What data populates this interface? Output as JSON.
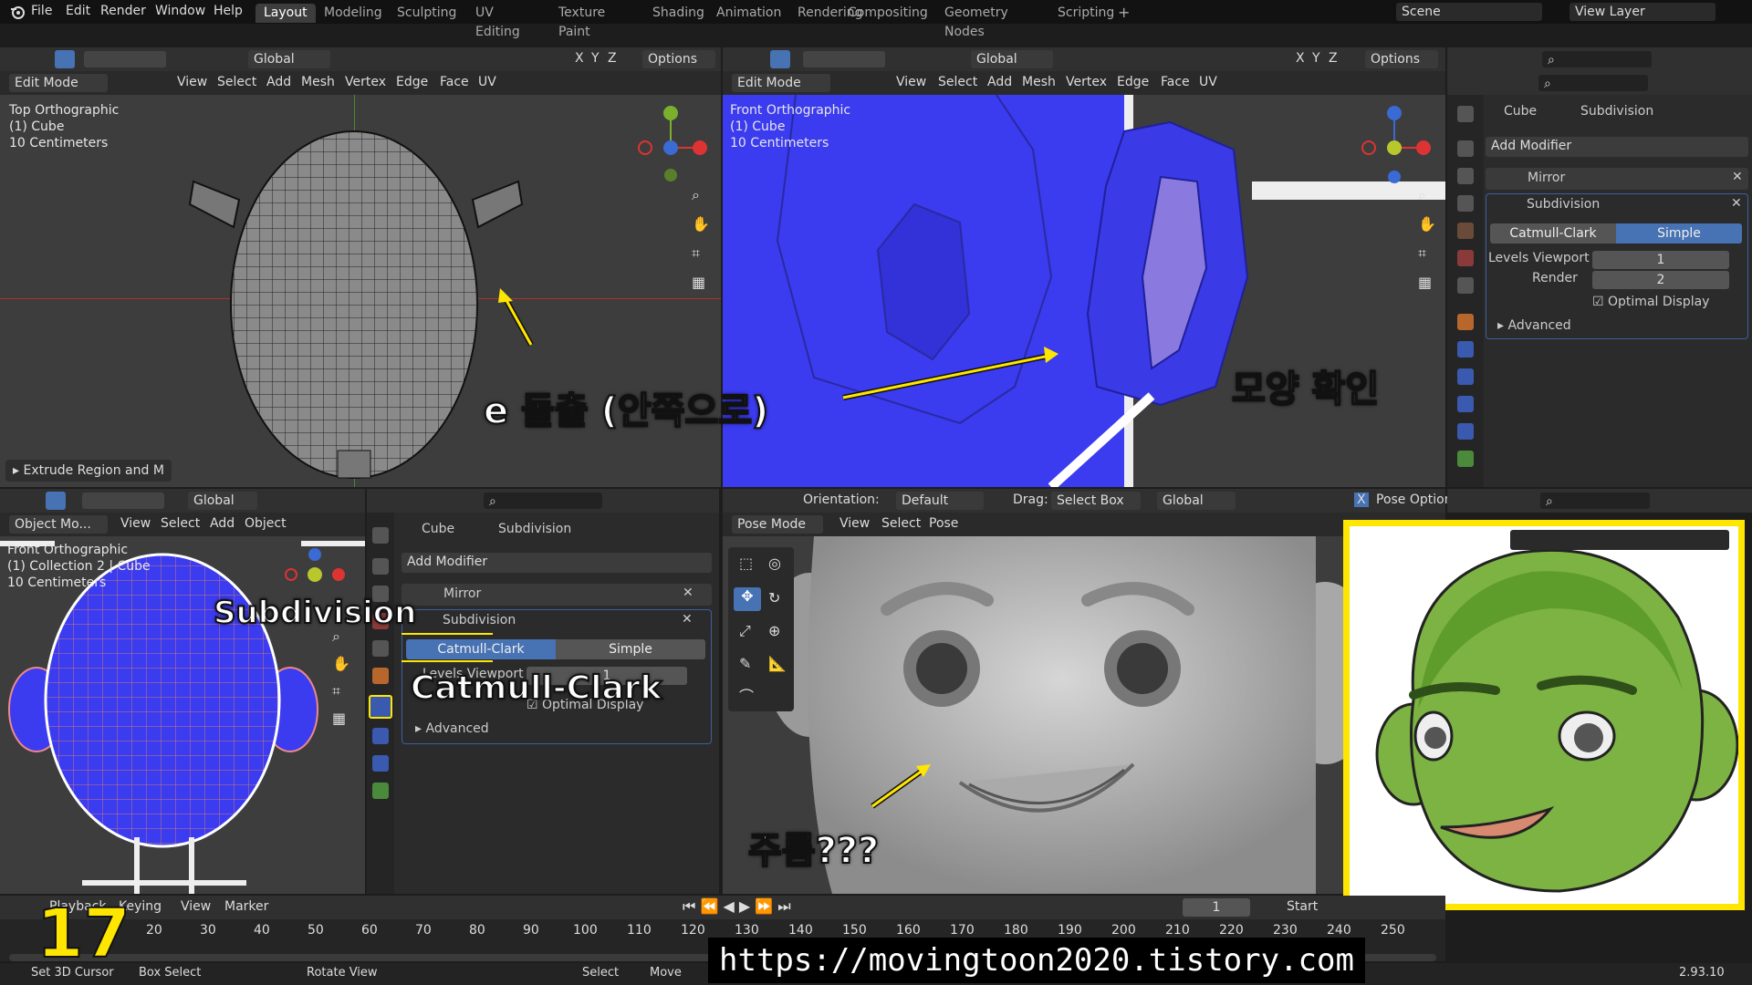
{
  "menubar": {
    "file": "File",
    "edit": "Edit",
    "render": "Render",
    "window": "Window",
    "help": "Help",
    "tabs": [
      "Layout",
      "Modeling",
      "Sculpting",
      "UV Editing",
      "Texture Paint",
      "Shading",
      "Animation",
      "Rendering",
      "Compositing",
      "Geometry Nodes",
      "Scripting"
    ],
    "active_tab": "Layout",
    "scene": "Scene",
    "view_layer": "View Layer"
  },
  "top_left_vp": {
    "header": {
      "orientation": "Global",
      "options": "Options",
      "x": "X",
      "y": "Y",
      "z": "Z"
    },
    "header2": {
      "mode": "Edit Mode",
      "view": "View",
      "select": "Select",
      "add": "Add",
      "mesh": "Mesh",
      "vertex": "Vertex",
      "edge": "Edge",
      "face": "Face",
      "uv": "UV"
    },
    "info": [
      "Top Orthographic",
      "(1) Cube",
      "10 Centimeters"
    ],
    "operator": "Extrude Region and M"
  },
  "top_mid_vp": {
    "header": {
      "orientation": "Global",
      "options": "Options",
      "x": "X",
      "y": "Y",
      "z": "Z"
    },
    "header2": {
      "mode": "Edit Mode",
      "view": "View",
      "select": "Select",
      "add": "Add",
      "mesh": "Mesh",
      "vertex": "Vertex",
      "edge": "Edge",
      "face": "Face",
      "uv": "UV"
    },
    "info": [
      "Front Orthographic",
      "(1) Cube",
      "10 Centimeters"
    ]
  },
  "top_props": {
    "object": "Cube",
    "modifier": "Subdivision",
    "add_modifier": "Add Modifier",
    "mirror": "Mirror",
    "subdivision": "Subdivision",
    "catmull": "Catmull-Clark",
    "simple": "Simple",
    "levels_viewport_label": "Levels Viewport",
    "levels_viewport": "1",
    "render_label": "Render",
    "render": "2",
    "optimal": "Optimal Display",
    "advanced": "Advanced"
  },
  "bottom_left_vp": {
    "header": {
      "orientation": "Global"
    },
    "header2": {
      "mode": "Object Mo...",
      "view": "View",
      "select": "Select",
      "add": "Add",
      "object": "Object"
    },
    "info": [
      "Front Orthographic",
      "(1) Collection 2 | Cube",
      "10 Centimeters"
    ]
  },
  "bottom_props": {
    "object": "Cube",
    "modifier": "Subdivision",
    "add_modifier": "Add Modifier",
    "mirror": "Mirror",
    "subdivision": "Subdivision",
    "catmull": "Catmull-Clark",
    "simple": "Simple",
    "levels_viewport_label": "Levels Viewport",
    "levels_viewport": "1",
    "optimal": "Optimal Display",
    "advanced": "Advanced"
  },
  "bottom_mid_vp": {
    "header": {
      "orientation_label": "Orientation:",
      "orientation": "Default",
      "drag_label": "Drag:",
      "drag": "Select Box",
      "global": "Global",
      "x": "X",
      "pose_options": "Pose Option"
    },
    "header2": {
      "mode": "Pose Mode",
      "view": "View",
      "select": "Select",
      "pose": "Pose"
    }
  },
  "timeline": {
    "playback": "Playback",
    "keying": "Keying",
    "view": "View",
    "marker": "Marker",
    "current_frame": "1",
    "start": "Start",
    "ticks": [
      "20",
      "30",
      "40",
      "50",
      "60",
      "70",
      "80",
      "90",
      "100",
      "110",
      "120",
      "130",
      "140",
      "150",
      "160",
      "170",
      "180",
      "190",
      "200",
      "210",
      "220",
      "230",
      "240",
      "250"
    ]
  },
  "statusbar": {
    "cursor": "Set 3D Cursor",
    "box": "Box Select",
    "rotate": "Rotate View",
    "select": "Select",
    "move": "Move",
    "version": "2.93.10"
  },
  "annotations": {
    "extrude": "e 돌출 (안쪽으로)",
    "check_shape": "모양 확인",
    "subdivision": "Subdivision",
    "catmull": "Catmull-Clark",
    "wrinkle": "주름???",
    "episode": "17",
    "url": "https://movingtoon2020.tistory.com"
  },
  "colors": {
    "accent_blue": "#4772b3",
    "mesh_blue": "#3b3bf0",
    "toon_green": "#7cb342",
    "highlight_yellow": "#ffe600"
  }
}
